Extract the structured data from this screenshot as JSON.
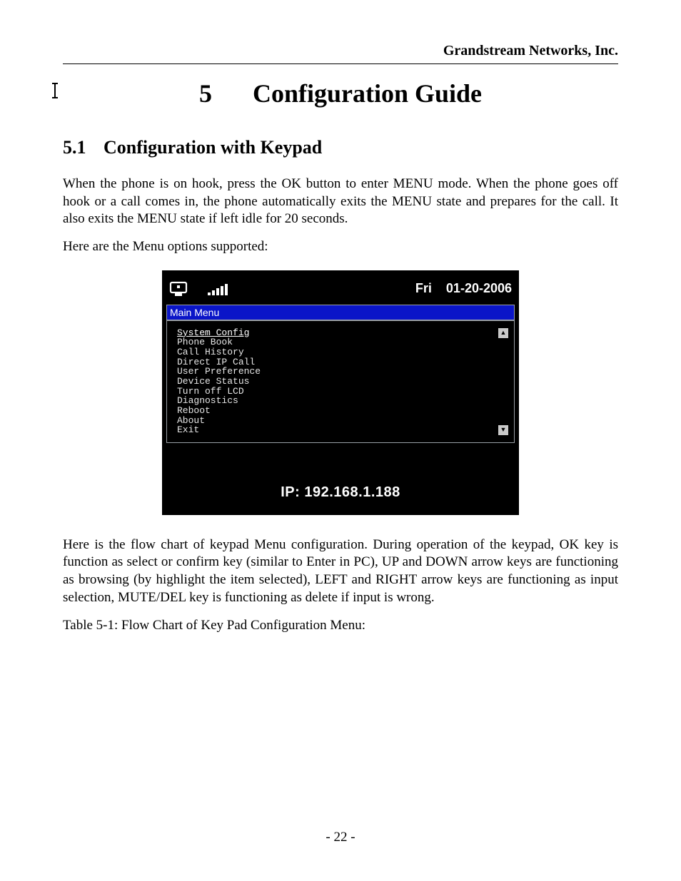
{
  "header": {
    "company": "Grandstream Networks, Inc."
  },
  "chapter": {
    "number": "5",
    "title": "Configuration Guide"
  },
  "section": {
    "number": "5.1",
    "title": "Configuration with Keypad"
  },
  "paragraphs": {
    "p1": "When the phone is on hook, press the OK button to enter MENU mode. When the phone goes off hook or a call comes in, the phone automatically exits the MENU state and prepares for the call. It also exits the MENU state if left idle for 20 seconds.",
    "p2": "Here are the Menu options supported:",
    "p3": "Here is the flow chart of keypad Menu configuration. During operation of the keypad, OK key is function as select or confirm key (similar to Enter in PC), UP and DOWN arrow keys are functioning as browsing (by highlight the item selected), LEFT and RIGHT arrow keys are functioning as input selection, MUTE/DEL key is functioning as delete if input is wrong.",
    "table_caption": "Table 5-1: Flow Chart of Key Pad Configuration Menu:"
  },
  "lcd": {
    "status": {
      "day": "Fri",
      "date": "01-20-2006"
    },
    "menu_title": "Main Menu",
    "items": [
      "System Config",
      "Phone Book",
      "Call History",
      "Direct IP Call",
      "User Preference",
      "Device Status",
      "Turn off LCD",
      "Diagnostics",
      "Reboot",
      "About",
      "Exit"
    ],
    "selected_index": 0,
    "ip_label": "IP: 192.168.1.188"
  },
  "footer": {
    "page_number": "- 22 -"
  }
}
